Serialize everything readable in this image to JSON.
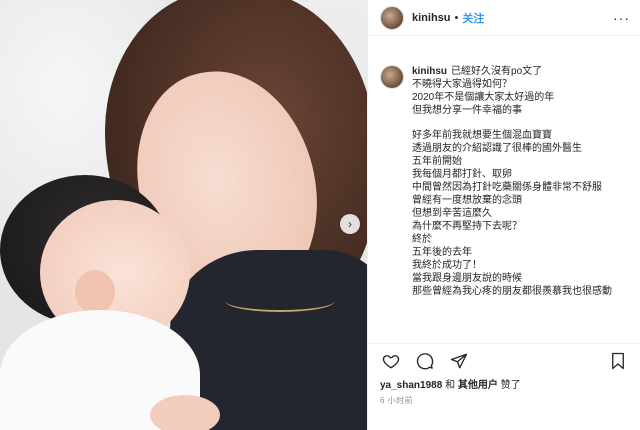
{
  "post": {
    "username": "kinihsu",
    "separator": "•",
    "follow_label": "关注",
    "more_label": "···"
  },
  "caption": {
    "username": "kinihsu",
    "lines": [
      "已經好久沒有po文了",
      "不曉得大家過得如何？",
      "2020年不是個讓大家太好過的年",
      "但我想分享一件幸福的事",
      "",
      "好多年前我就想要生個混血寶寶",
      "透過朋友的介紹認識了很棒的國外醫生",
      "五年前開始",
      "我每個月都打針、取卵",
      "中間曾然因為打針吃藥關係身體非常不舒服",
      "曾經有一度想放棄的念頭",
      "但想到辛苦這麼久",
      "為什麼不再堅持下去呢？",
      "終於",
      "五年後的去年",
      "我終於成功了！",
      "當我跟身邊朋友說的時候",
      "那些曾經為我心疼的朋友都很羨慕我也很感動"
    ]
  },
  "icons": {
    "heart": "heart-icon",
    "comment": "comment-icon",
    "share": "share-icon",
    "bookmark": "bookmark-icon",
    "next": "chevron-right-icon"
  },
  "likes": {
    "user": "ya_shan1988",
    "conj": "和",
    "others": "其他用户",
    "verb": "赞了"
  },
  "timestamp": "6 小时前",
  "colors": {
    "follow": "#3897f0",
    "muted": "#8e8e8e"
  }
}
